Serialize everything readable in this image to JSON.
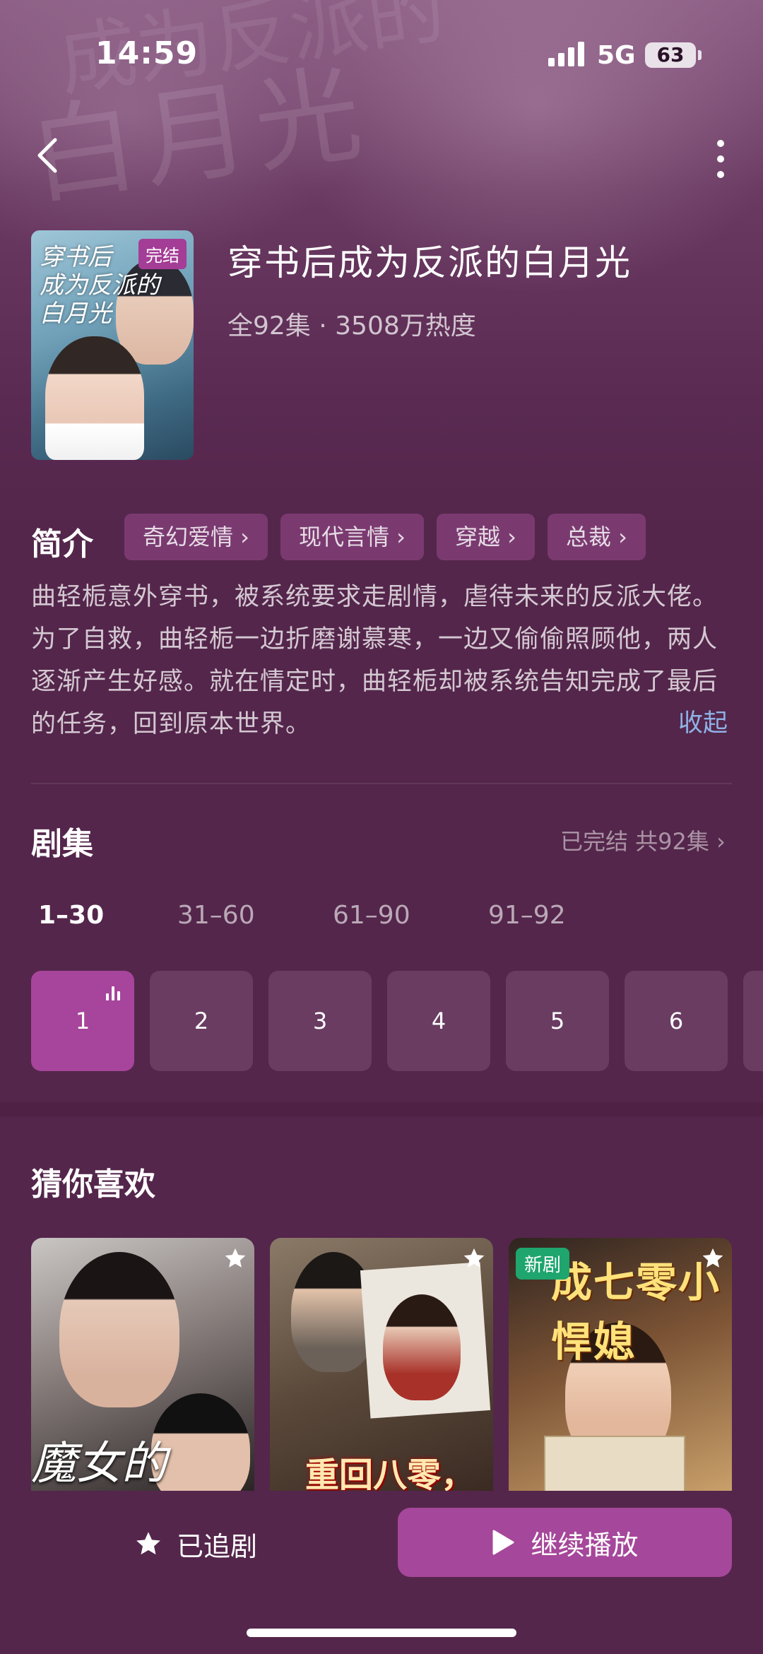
{
  "status_bar": {
    "time": "14:59",
    "network": "5G",
    "battery": "63"
  },
  "drama": {
    "title": "穿书后成为反派的白月光",
    "meta": "全92集 · 3508万热度",
    "poster_badge": "完结",
    "poster_title_art": "穿书后成为反派的白月光"
  },
  "intro": {
    "label": "简介",
    "tags": [
      "奇幻爱情 ›",
      "现代言情 ›",
      "穿越 ›",
      "总裁 ›"
    ],
    "synopsis": "曲轻栀意外穿书，被系统要求走剧情，虐待未来的反派大佬。为了自救，曲轻栀一边折磨谢慕寒，一边又偷偷照顾他，两人逐渐产生好感。就在情定时，曲轻栀却被系统告知完成了最后的任务，回到原本世界。",
    "collapse_label": "收起"
  },
  "episodes": {
    "label": "剧集",
    "status": "已完结 共92集 ›",
    "ranges": [
      "1–30",
      "31–60",
      "61–90",
      "91–92"
    ],
    "active_range_index": 0,
    "items": [
      "1",
      "2",
      "3",
      "4",
      "5",
      "6"
    ],
    "active_episode_index": 0
  },
  "recommend": {
    "label": "猜你喜欢",
    "cards": [
      {
        "title_art": "魔女的",
        "badge": ""
      },
      {
        "title_art": "重回八零，",
        "badge": ""
      },
      {
        "title_art": "成七零小悍媳",
        "badge": "新剧"
      }
    ]
  },
  "actions": {
    "follow_label": "已追剧",
    "play_label": "继续播放"
  },
  "colors": {
    "background": "#54264b",
    "accent": "#a5479a",
    "link": "#8fb2e6",
    "new_badge": "#1fa56e"
  },
  "icons": [
    "back-arrow-icon",
    "more-vertical-icon",
    "star-icon",
    "play-icon",
    "playing-bars-icon",
    "chevron-right-icon"
  ]
}
